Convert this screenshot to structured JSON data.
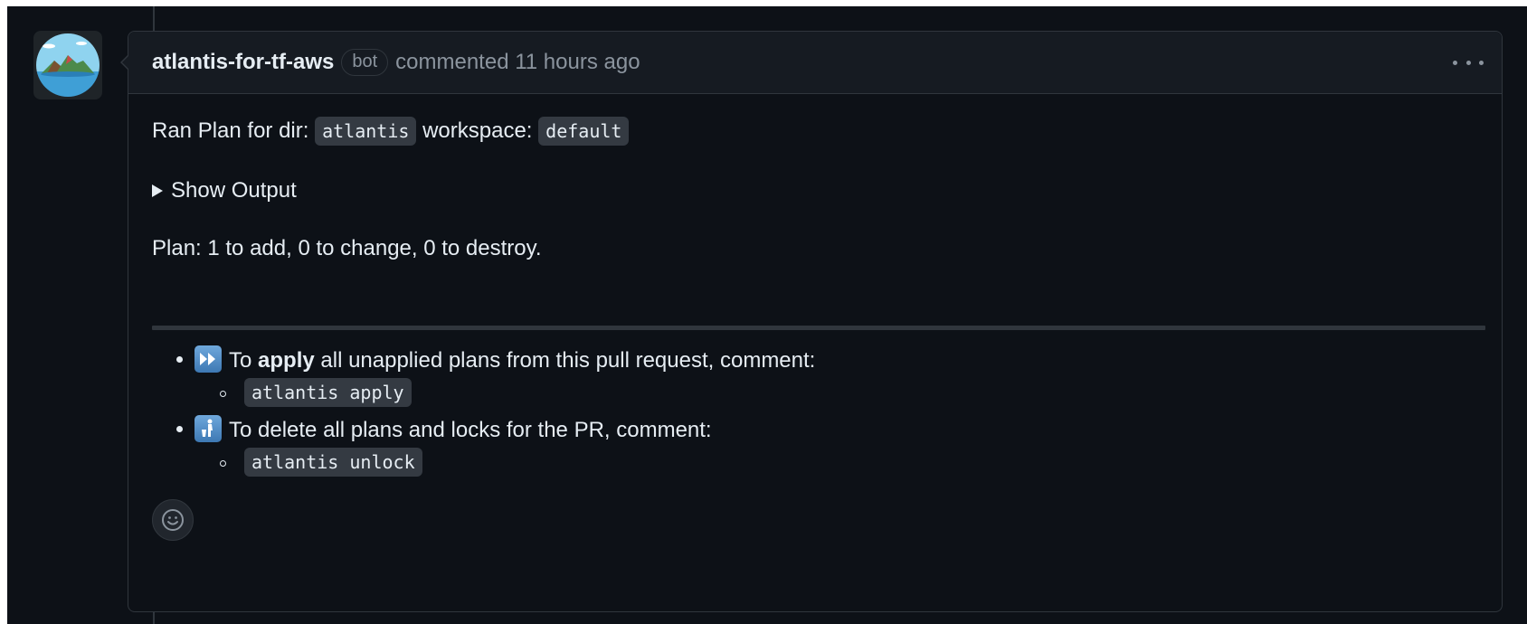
{
  "comment": {
    "author": "atlantis-for-tf-aws",
    "badge": "bot",
    "meta": "commented 11 hours ago"
  },
  "body": {
    "ran_plan_prefix": "Ran Plan for dir:",
    "dir": "atlantis",
    "workspace_label": "workspace:",
    "workspace": "default",
    "details_summary": "Show Output",
    "plan_summary": "Plan: 1 to add, 0 to change, 0 to destroy.",
    "items": [
      {
        "emoji": "fast-forward-icon",
        "prefix": "To",
        "bold": "apply",
        "suffix": "all unapplied plans from this pull request, comment:",
        "command": "atlantis apply"
      },
      {
        "emoji": "put-litter-in-its-place-icon",
        "text": "To delete all plans and locks for the PR, comment:",
        "command": "atlantis unlock"
      }
    ]
  },
  "colors": {
    "background": "#0d1117",
    "header": "#161b22",
    "border": "#30363d",
    "text": "#e6edf3",
    "muted": "#8b949e"
  }
}
